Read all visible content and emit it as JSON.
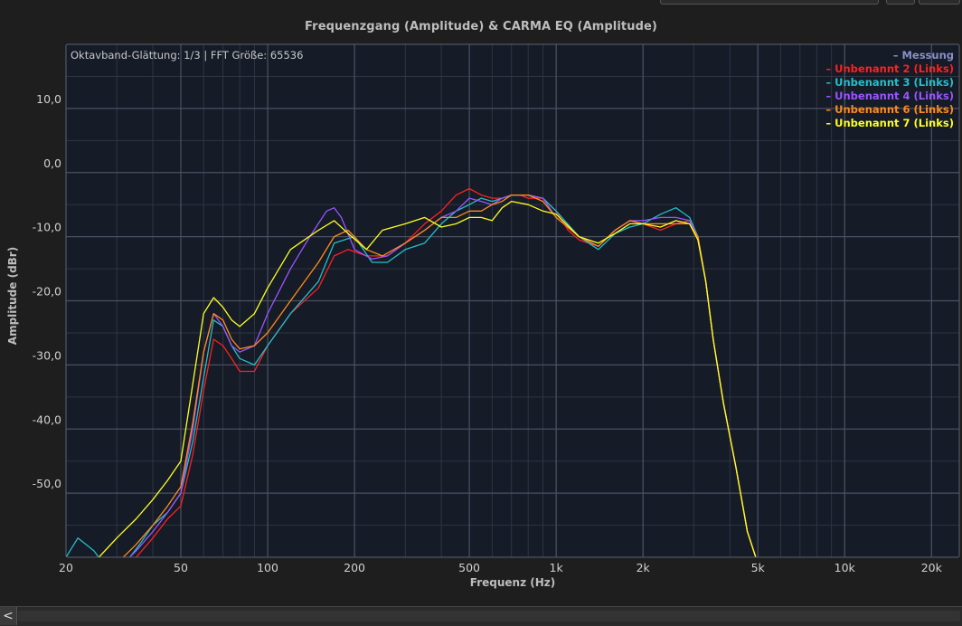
{
  "colors": {
    "background": "#1e1e1e",
    "plot_background": "#151b27",
    "grid_major": "#4a5160",
    "grid_minor": "#2f3542",
    "text": "#d0d0d0",
    "measurement": "#8a8fc8",
    "unbenannt2": "#ff2020",
    "unbenannt3": "#22c0c8",
    "unbenannt4": "#9a55ff",
    "unbenannt6": "#ff8a1c",
    "unbenannt7": "#ffff20"
  },
  "chart_data": {
    "type": "line",
    "title": "Frequenzgang (Amplitude) & CARMA EQ (Amplitude)",
    "subtitle": "Oktavband-Glättung: 1/3 | FFT Größe: 65536",
    "xlabel": "Frequenz (Hz)",
    "ylabel": "Amplitude (dBr)",
    "xscale": "log",
    "xlim": [
      20,
      25000
    ],
    "ylim": [
      -60,
      20
    ],
    "x_ticks": [
      20,
      50,
      100,
      200,
      500,
      1000,
      2000,
      5000,
      10000,
      20000
    ],
    "x_tick_labels": [
      "20",
      "50",
      "100",
      "200",
      "500",
      "1k",
      "2k",
      "5k",
      "10k",
      "20k"
    ],
    "y_ticks": [
      10,
      0,
      -10,
      -20,
      -30,
      -40,
      -50
    ],
    "y_tick_labels": [
      "10,0",
      "0,0",
      "-10,0",
      "-20,0",
      "-30,0",
      "-40,0",
      "-50,0"
    ],
    "grid": true,
    "legend_position": "top-right",
    "legend": [
      {
        "label": "Messung",
        "marker": "–",
        "color_key": "measurement"
      },
      {
        "label": "Unbenannt 2 (Links)",
        "marker": "–",
        "color_key": "unbenannt2"
      },
      {
        "label": "Unbenannt 3 (Links)",
        "marker": "–",
        "color_key": "unbenannt3"
      },
      {
        "label": "Unbenannt 4 (Links)",
        "marker": "–",
        "color_key": "unbenannt4"
      },
      {
        "label": "Unbenannt 6 (Links)",
        "marker": "–",
        "color_key": "unbenannt6"
      },
      {
        "label": "Unbenannt 7 (Links)",
        "marker": "–",
        "color_key": "unbenannt7"
      }
    ],
    "series": [
      {
        "name": "Unbenannt 2 (Links)",
        "color_key": "unbenannt2",
        "x": [
          26,
          30,
          35,
          40,
          45,
          50,
          55,
          60,
          65,
          70,
          75,
          80,
          90,
          100,
          120,
          150,
          170,
          190,
          220,
          260,
          300,
          350,
          400,
          450,
          500,
          550,
          600,
          650,
          700,
          750,
          800,
          900,
          1000,
          1100,
          1200,
          1400,
          1600,
          1800,
          2000,
          2300,
          2600,
          2900,
          3100,
          3300,
          3500,
          3800,
          4200,
          4600,
          5000
        ],
        "y": [
          -61,
          -62,
          -60,
          -57,
          -54,
          -52,
          -44,
          -34,
          -26,
          -27,
          -29,
          -31,
          -31,
          -27,
          -22,
          -18,
          -13,
          -12,
          -13,
          -13,
          -11,
          -8,
          -6,
          -3.5,
          -2.5,
          -3.5,
          -4,
          -4,
          -3.5,
          -3.5,
          -4,
          -4,
          -6,
          -9,
          -10.5,
          -11.5,
          -9,
          -7.5,
          -8,
          -9,
          -8,
          -7.5,
          -10,
          -17,
          -26,
          -36,
          -46,
          -56,
          -61
        ]
      },
      {
        "name": "Unbenannt 3 (Links)",
        "color_key": "unbenannt3",
        "x": [
          20,
          22,
          25,
          28,
          32,
          36,
          40,
          45,
          50,
          55,
          60,
          65,
          70,
          75,
          80,
          90,
          100,
          120,
          150,
          170,
          200,
          230,
          260,
          300,
          350,
          400,
          450,
          500,
          550,
          600,
          650,
          700,
          800,
          900,
          1000,
          1200,
          1400,
          1600,
          1800,
          2000,
          2300,
          2600,
          2900,
          3100,
          3300,
          3500,
          3800,
          4200,
          4600,
          5000
        ],
        "y": [
          -60,
          -57,
          -59,
          -62,
          -61,
          -58,
          -55,
          -53,
          -50,
          -42,
          -32,
          -23,
          -24,
          -27,
          -29,
          -30,
          -27,
          -22,
          -17,
          -11,
          -10,
          -14,
          -14,
          -12,
          -11,
          -8,
          -6,
          -5,
          -4,
          -4.5,
          -4,
          -3.5,
          -3.5,
          -4,
          -6,
          -10,
          -12,
          -9.5,
          -8.5,
          -8,
          -6.5,
          -5.5,
          -7,
          -10,
          -17,
          -26,
          -36,
          -46,
          -56,
          -61
        ]
      },
      {
        "name": "Unbenannt 4 (Links)",
        "color_key": "unbenannt4",
        "x": [
          26,
          30,
          35,
          40,
          45,
          50,
          55,
          60,
          65,
          70,
          75,
          80,
          90,
          100,
          120,
          140,
          160,
          170,
          180,
          200,
          230,
          260,
          300,
          350,
          400,
          450,
          500,
          550,
          600,
          650,
          700,
          800,
          900,
          1000,
          1200,
          1400,
          1600,
          1800,
          2000,
          2300,
          2600,
          2900,
          3100,
          3300,
          3500,
          3800,
          4200,
          4600,
          5000
        ],
        "y": [
          -61,
          -62,
          -59,
          -56,
          -53,
          -50,
          -40,
          -28,
          -22,
          -24,
          -27,
          -28,
          -27,
          -22,
          -15,
          -10,
          -6,
          -5.5,
          -7,
          -12,
          -13.5,
          -13,
          -11,
          -9,
          -7,
          -6,
          -4,
          -4.5,
          -5,
          -4,
          -3.5,
          -3.5,
          -4,
          -7,
          -10,
          -11.5,
          -9,
          -7.5,
          -7.5,
          -7,
          -7,
          -7.5,
          -10,
          -17,
          -26,
          -36,
          -46,
          -56,
          -61
        ]
      },
      {
        "name": "Unbenannt 6 (Links)",
        "color_key": "unbenannt6",
        "x": [
          26,
          30,
          35,
          40,
          45,
          50,
          55,
          60,
          65,
          70,
          75,
          80,
          90,
          100,
          120,
          150,
          170,
          190,
          220,
          250,
          300,
          350,
          400,
          450,
          500,
          550,
          600,
          650,
          700,
          800,
          900,
          1000,
          1200,
          1400,
          1600,
          1800,
          2000,
          2300,
          2600,
          2900,
          3100,
          3300,
          3500,
          3800,
          4200,
          4600,
          5000
        ],
        "y": [
          -61,
          -61,
          -58,
          -55,
          -52,
          -49,
          -39,
          -28,
          -22,
          -23,
          -26,
          -27.5,
          -27,
          -25,
          -20,
          -14,
          -10,
          -9,
          -12,
          -13,
          -11,
          -9,
          -7,
          -7,
          -6,
          -6,
          -5,
          -4.5,
          -3.5,
          -3.5,
          -4.5,
          -7,
          -10,
          -11.5,
          -9,
          -7.5,
          -8,
          -8,
          -8,
          -8,
          -10,
          -17,
          -26,
          -36,
          -46,
          -56,
          -61
        ]
      },
      {
        "name": "Unbenannt 7 (Links)",
        "color_key": "unbenannt7",
        "x": [
          26,
          30,
          35,
          40,
          45,
          50,
          55,
          60,
          65,
          70,
          75,
          80,
          90,
          100,
          120,
          150,
          170,
          190,
          220,
          250,
          300,
          350,
          400,
          450,
          500,
          550,
          600,
          650,
          700,
          800,
          900,
          1000,
          1200,
          1400,
          1600,
          1800,
          2000,
          2300,
          2600,
          2900,
          3100,
          3300,
          3500,
          3800,
          4200,
          4600,
          5000
        ],
        "y": [
          -60,
          -57,
          -54,
          -51,
          -48,
          -45,
          -33,
          -22,
          -19.5,
          -21,
          -23,
          -24,
          -22,
          -18,
          -12,
          -9,
          -7.5,
          -9.5,
          -12,
          -9,
          -8,
          -7,
          -8.5,
          -8,
          -7,
          -7,
          -7.5,
          -5.5,
          -4.5,
          -5,
          -6,
          -6.5,
          -10,
          -11,
          -9.5,
          -8,
          -8,
          -8.5,
          -7.5,
          -8,
          -10.5,
          -17,
          -26,
          -36,
          -46,
          -56,
          -61
        ]
      }
    ]
  },
  "scrollbar": {
    "left_arrow": "<"
  }
}
